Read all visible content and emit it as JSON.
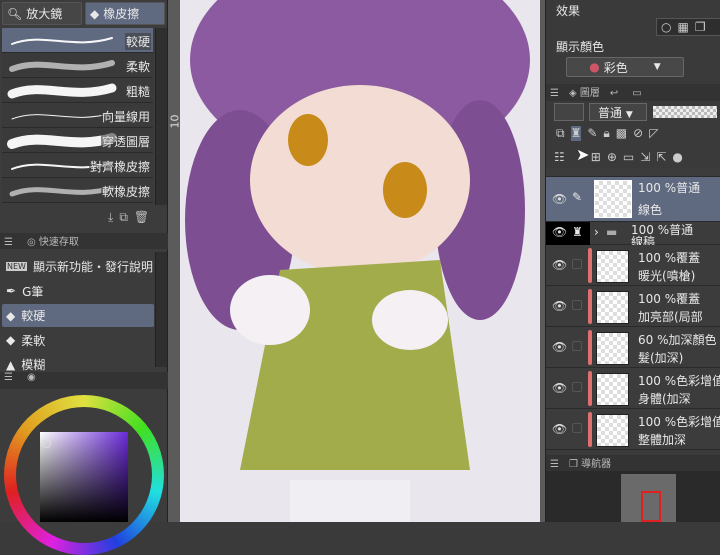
{
  "tool_tabs": [
    {
      "label": "放大鏡",
      "icon": "magnifier-icon"
    },
    {
      "label": "橡皮擦",
      "icon": "eraser-icon"
    }
  ],
  "brushes": [
    {
      "label": "較硬"
    },
    {
      "label": "柔軟"
    },
    {
      "label": "粗糙"
    },
    {
      "label": "向量線用"
    },
    {
      "label": "穿透圖層"
    },
    {
      "label": "對齊橡皮擦"
    },
    {
      "label": "軟橡皮擦"
    }
  ],
  "quick_access": {
    "title": "快速存取",
    "items": [
      {
        "label": "顯示新功能・發行說明",
        "badge": "NEW"
      },
      {
        "label": "G筆"
      },
      {
        "label": "較硬"
      },
      {
        "label": "柔軟"
      },
      {
        "label": "模糊"
      }
    ]
  },
  "canvas": {
    "ruler_label": "10"
  },
  "right": {
    "effect_label": "效果",
    "display_color_label": "顯示顏色",
    "display_color_value": "彩色",
    "layer_tab": "圖層",
    "blend_mode": "普通",
    "navigator_tab": "導航器"
  },
  "layers": [
    {
      "opacity_mode": "100 %普通",
      "name": "線色",
      "selected": true
    },
    {
      "opacity_mode": "100 %普通",
      "name": "線稿",
      "folder": true
    },
    {
      "opacity_mode": "100 %覆蓋",
      "name": "暖光(噴槍)"
    },
    {
      "opacity_mode": "100 %覆蓋",
      "name": "加亮部(局部"
    },
    {
      "opacity_mode": "60 %加深顏色",
      "name": "髮(加深)"
    },
    {
      "opacity_mode": "100 %色彩增值",
      "name": "身體(加深"
    },
    {
      "opacity_mode": "100 %色彩增值",
      "name": "整體加深"
    }
  ],
  "colors": {
    "selected": "#5f6a80",
    "clip_bar": "#e07070"
  }
}
